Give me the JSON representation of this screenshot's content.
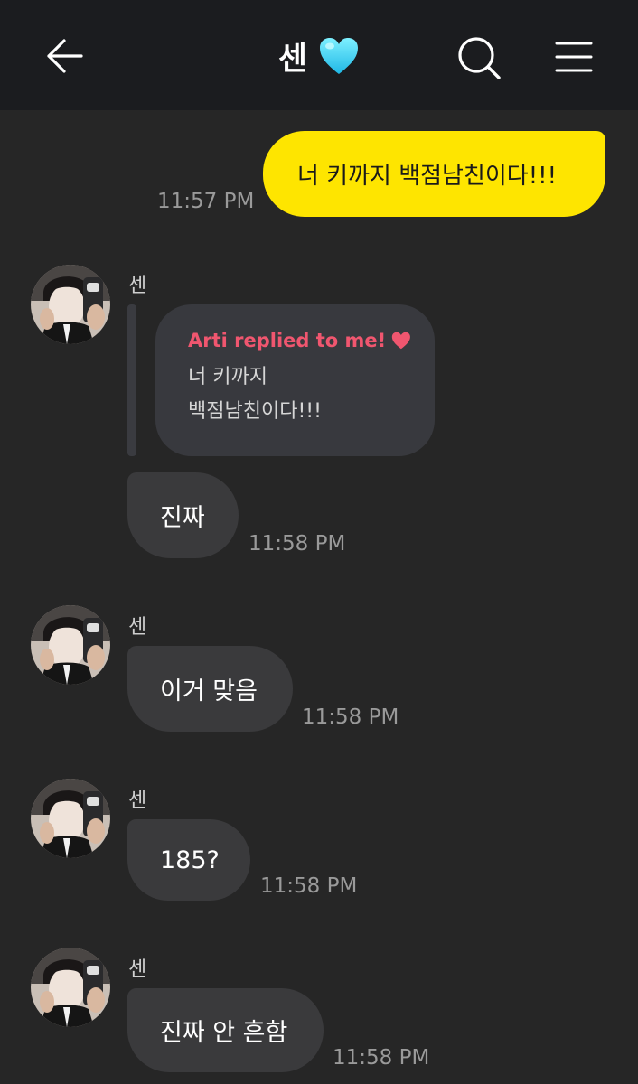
{
  "header": {
    "title": "센",
    "back_icon": "arrow-left-icon",
    "heart_icon": "blue-heart-icon",
    "search_icon": "search-icon",
    "menu_icon": "menu-icon"
  },
  "colors": {
    "header_bg": "#1b1c1f",
    "chat_bg": "#262626",
    "my_bubble": "#fee500",
    "other_bubble": "#3a3a3c",
    "reply_title": "#f0566f",
    "heart_blue": "#39d3f5"
  },
  "messages": [
    {
      "from": "me",
      "text": "너 키까지 백점남친이다!!!",
      "time": "11:57 PM"
    },
    {
      "from": "센",
      "sender": "센",
      "reply": {
        "title": "Arti replied to me!",
        "heart_icon": "red-heart-icon",
        "quoted_text": "너 키까지 백점남친이다!!!"
      },
      "text": "진짜",
      "time": "11:58 PM"
    },
    {
      "from": "센",
      "sender": "센",
      "text": "이거 맞음",
      "time": "11:58 PM"
    },
    {
      "from": "센",
      "sender": "센",
      "text": "185?",
      "time": "11:58 PM"
    },
    {
      "from": "센",
      "sender": "센",
      "text": "진짜 안 흔함",
      "time": "11:58 PM"
    }
  ]
}
